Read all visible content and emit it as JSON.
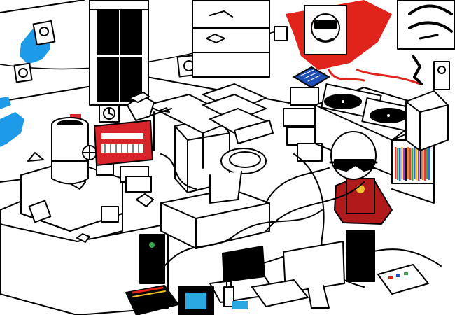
{
  "scene": {
    "background": "#ffffff",
    "colors": {
      "ink": "#000000",
      "paint_red": "#e0231b",
      "paint_blue": "#1e9be8",
      "character_shirt": "#b01a1a",
      "sampler_red": "#d9232a",
      "sampler_blue": "#1f4fb5",
      "screen_blue": "#2aa8e0",
      "record_spines": [
        "#e63a3a",
        "#3aa64c",
        "#2b6fd6",
        "#f2c12e",
        "#9b3fc9",
        "#111111",
        "#ff7f2a"
      ]
    }
  },
  "objects": {
    "character": {
      "icon": "kid-with-shades"
    },
    "turntables": {
      "icon": "turntable"
    },
    "sampler": {
      "icon": "drum-machine"
    },
    "red_synth": {
      "icon": "synthesizer"
    },
    "toilet": {
      "icon": "toilet"
    },
    "alchemiter": {
      "icon": "alchemiter"
    },
    "computer": {
      "icon": "monitor"
    },
    "speakers": {
      "icon": "speaker"
    },
    "remote": {
      "icon": "remote"
    },
    "window": {
      "icon": "window"
    },
    "photos": {
      "icon": "photo"
    },
    "clock": {
      "icon": "clock"
    },
    "poster": {
      "icon": "poster"
    }
  }
}
